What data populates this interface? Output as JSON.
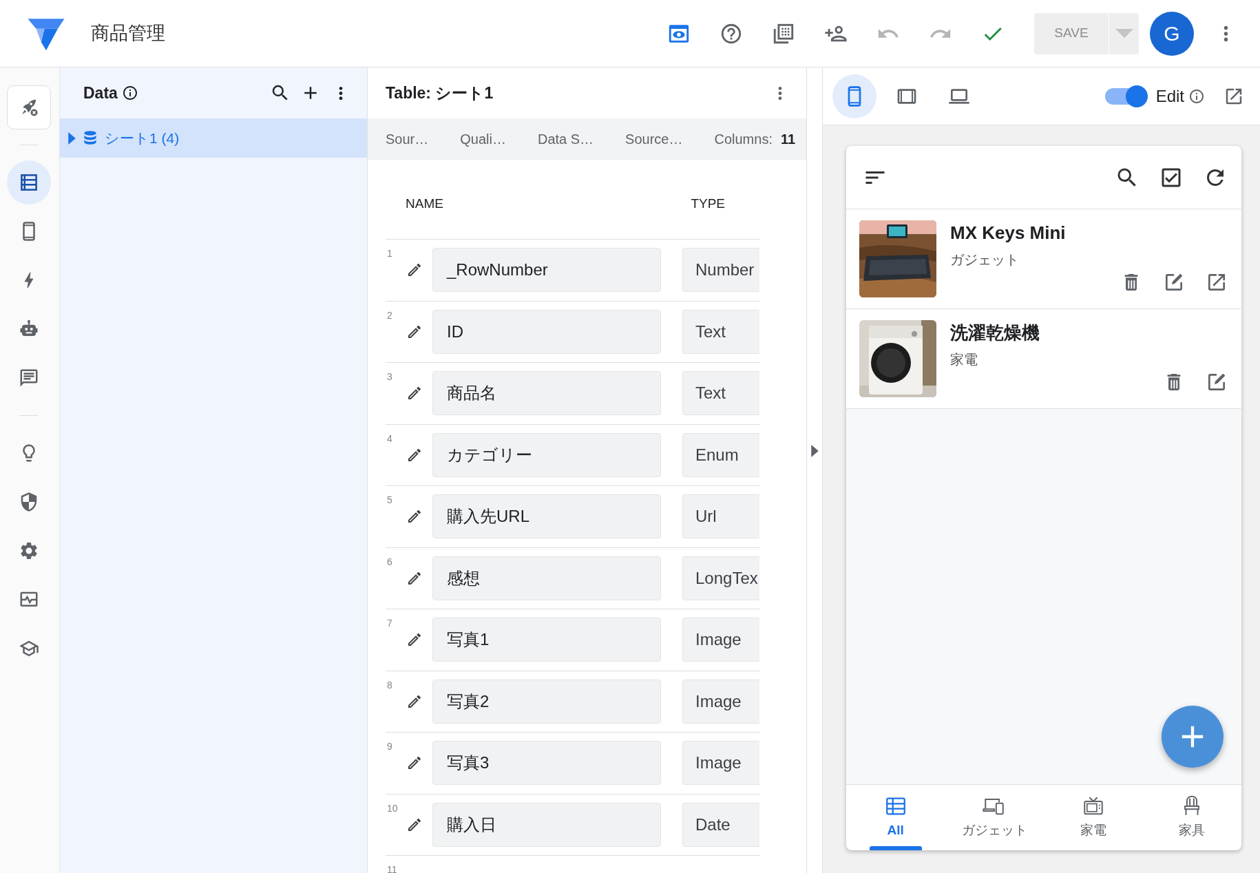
{
  "app": {
    "title": "商品管理"
  },
  "toolbar": [
    {
      "active": true,
      "disabled": false
    },
    {
      "active": false,
      "disabled": false
    },
    {
      "active": false,
      "disabled": false
    },
    {
      "active": false,
      "disabled": false
    },
    {
      "active": false,
      "disabled": true
    },
    {
      "active": false,
      "disabled": true
    },
    {
      "active": false,
      "disabled": false
    }
  ],
  "save_button": {
    "label": "SAVE",
    "disabled": true
  },
  "avatar": "G",
  "rail": [
    {
      "kind": "boxed",
      "selected": false
    },
    {
      "kind": "plain",
      "selected": true
    },
    {
      "kind": "plain",
      "selected": false
    },
    {
      "kind": "plain",
      "selected": false
    },
    {
      "kind": "plain",
      "selected": false
    },
    {
      "kind": "plain",
      "selected": false
    },
    {
      "kind": "plain",
      "selected": false
    },
    {
      "kind": "plain",
      "selected": false
    },
    {
      "kind": "plain",
      "selected": false
    },
    {
      "kind": "plain",
      "selected": false
    },
    {
      "kind": "plain",
      "selected": false
    }
  ],
  "data_panel": {
    "title": "Data",
    "tree": [
      {
        "label": "シート1 (4)",
        "selected": true,
        "expanded": false
      }
    ]
  },
  "table_panel": {
    "title": "Table: シート1",
    "tabs": [
      "Sour…",
      "Quali…",
      "Data S…",
      "Source…"
    ],
    "columns_label": "Columns:",
    "columns_count": "11",
    "headers": [
      "NAME",
      "TYPE"
    ],
    "rows": [
      {
        "number": "1",
        "name": "_RowNumber",
        "type": "Number"
      },
      {
        "number": "2",
        "name": "ID",
        "type": "Text"
      },
      {
        "number": "3",
        "name": "商品名",
        "type": "Text"
      },
      {
        "number": "4",
        "name": "カテゴリー",
        "type": "Enum"
      },
      {
        "number": "5",
        "name": "購入先URL",
        "type": "Url"
      },
      {
        "number": "6",
        "name": "感想",
        "type": "LongTex"
      },
      {
        "number": "7",
        "name": "写真1",
        "type": "Image"
      },
      {
        "number": "8",
        "name": "写真2",
        "type": "Image"
      },
      {
        "number": "9",
        "name": "写真3",
        "type": "Image"
      },
      {
        "number": "10",
        "name": "購入日",
        "type": "Date"
      },
      {
        "number": "11"
      }
    ]
  },
  "preview": {
    "devices": [
      {
        "selected": true
      },
      {
        "selected": false
      },
      {
        "selected": false
      }
    ],
    "edit_toggle": {
      "on": true,
      "label": "Edit"
    },
    "items": [
      {
        "title": "MX Keys Mini",
        "subtitle": "ガジェット",
        "link": true
      },
      {
        "title": "洗濯乾燥機",
        "subtitle": "家電",
        "link": false
      }
    ],
    "nav": [
      {
        "label": "All",
        "selected": true
      },
      {
        "label": "ガジェット",
        "selected": false
      },
      {
        "label": "家電",
        "selected": false
      },
      {
        "label": "家具",
        "selected": false
      }
    ]
  }
}
